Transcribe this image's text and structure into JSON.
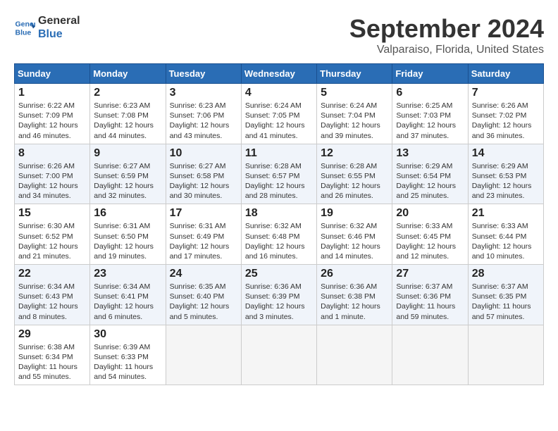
{
  "header": {
    "logo_line1": "General",
    "logo_line2": "Blue",
    "title": "September 2024",
    "subtitle": "Valparaiso, Florida, United States"
  },
  "calendar": {
    "days_of_week": [
      "Sunday",
      "Monday",
      "Tuesday",
      "Wednesday",
      "Thursday",
      "Friday",
      "Saturday"
    ],
    "weeks": [
      [
        {
          "empty": true
        },
        {
          "empty": true
        },
        {
          "empty": true
        },
        {
          "empty": true
        },
        {
          "empty": true
        },
        {
          "empty": true
        },
        {
          "empty": true
        }
      ]
    ],
    "cells": [
      {
        "day": 1,
        "col": 0,
        "sunrise": "6:22 AM",
        "sunset": "7:09 PM",
        "daylight": "12 hours and 46 minutes."
      },
      {
        "day": 2,
        "col": 1,
        "sunrise": "6:23 AM",
        "sunset": "7:08 PM",
        "daylight": "12 hours and 44 minutes."
      },
      {
        "day": 3,
        "col": 2,
        "sunrise": "6:23 AM",
        "sunset": "7:06 PM",
        "daylight": "12 hours and 43 minutes."
      },
      {
        "day": 4,
        "col": 3,
        "sunrise": "6:24 AM",
        "sunset": "7:05 PM",
        "daylight": "12 hours and 41 minutes."
      },
      {
        "day": 5,
        "col": 4,
        "sunrise": "6:24 AM",
        "sunset": "7:04 PM",
        "daylight": "12 hours and 39 minutes."
      },
      {
        "day": 6,
        "col": 5,
        "sunrise": "6:25 AM",
        "sunset": "7:03 PM",
        "daylight": "12 hours and 37 minutes."
      },
      {
        "day": 7,
        "col": 6,
        "sunrise": "6:26 AM",
        "sunset": "7:02 PM",
        "daylight": "12 hours and 36 minutes."
      },
      {
        "day": 8,
        "col": 0,
        "sunrise": "6:26 AM",
        "sunset": "7:00 PM",
        "daylight": "12 hours and 34 minutes."
      },
      {
        "day": 9,
        "col": 1,
        "sunrise": "6:27 AM",
        "sunset": "6:59 PM",
        "daylight": "12 hours and 32 minutes."
      },
      {
        "day": 10,
        "col": 2,
        "sunrise": "6:27 AM",
        "sunset": "6:58 PM",
        "daylight": "12 hours and 30 minutes."
      },
      {
        "day": 11,
        "col": 3,
        "sunrise": "6:28 AM",
        "sunset": "6:57 PM",
        "daylight": "12 hours and 28 minutes."
      },
      {
        "day": 12,
        "col": 4,
        "sunrise": "6:28 AM",
        "sunset": "6:55 PM",
        "daylight": "12 hours and 26 minutes."
      },
      {
        "day": 13,
        "col": 5,
        "sunrise": "6:29 AM",
        "sunset": "6:54 PM",
        "daylight": "12 hours and 25 minutes."
      },
      {
        "day": 14,
        "col": 6,
        "sunrise": "6:29 AM",
        "sunset": "6:53 PM",
        "daylight": "12 hours and 23 minutes."
      },
      {
        "day": 15,
        "col": 0,
        "sunrise": "6:30 AM",
        "sunset": "6:52 PM",
        "daylight": "12 hours and 21 minutes."
      },
      {
        "day": 16,
        "col": 1,
        "sunrise": "6:31 AM",
        "sunset": "6:50 PM",
        "daylight": "12 hours and 19 minutes."
      },
      {
        "day": 17,
        "col": 2,
        "sunrise": "6:31 AM",
        "sunset": "6:49 PM",
        "daylight": "12 hours and 17 minutes."
      },
      {
        "day": 18,
        "col": 3,
        "sunrise": "6:32 AM",
        "sunset": "6:48 PM",
        "daylight": "12 hours and 16 minutes."
      },
      {
        "day": 19,
        "col": 4,
        "sunrise": "6:32 AM",
        "sunset": "6:46 PM",
        "daylight": "12 hours and 14 minutes."
      },
      {
        "day": 20,
        "col": 5,
        "sunrise": "6:33 AM",
        "sunset": "6:45 PM",
        "daylight": "12 hours and 12 minutes."
      },
      {
        "day": 21,
        "col": 6,
        "sunrise": "6:33 AM",
        "sunset": "6:44 PM",
        "daylight": "12 hours and 10 minutes."
      },
      {
        "day": 22,
        "col": 0,
        "sunrise": "6:34 AM",
        "sunset": "6:43 PM",
        "daylight": "12 hours and 8 minutes."
      },
      {
        "day": 23,
        "col": 1,
        "sunrise": "6:34 AM",
        "sunset": "6:41 PM",
        "daylight": "12 hours and 6 minutes."
      },
      {
        "day": 24,
        "col": 2,
        "sunrise": "6:35 AM",
        "sunset": "6:40 PM",
        "daylight": "12 hours and 5 minutes."
      },
      {
        "day": 25,
        "col": 3,
        "sunrise": "6:36 AM",
        "sunset": "6:39 PM",
        "daylight": "12 hours and 3 minutes."
      },
      {
        "day": 26,
        "col": 4,
        "sunrise": "6:36 AM",
        "sunset": "6:38 PM",
        "daylight": "12 hours and 1 minute."
      },
      {
        "day": 27,
        "col": 5,
        "sunrise": "6:37 AM",
        "sunset": "6:36 PM",
        "daylight": "11 hours and 59 minutes."
      },
      {
        "day": 28,
        "col": 6,
        "sunrise": "6:37 AM",
        "sunset": "6:35 PM",
        "daylight": "11 hours and 57 minutes."
      },
      {
        "day": 29,
        "col": 0,
        "sunrise": "6:38 AM",
        "sunset": "6:34 PM",
        "daylight": "11 hours and 55 minutes."
      },
      {
        "day": 30,
        "col": 1,
        "sunrise": "6:39 AM",
        "sunset": "6:33 PM",
        "daylight": "11 hours and 54 minutes."
      }
    ]
  }
}
